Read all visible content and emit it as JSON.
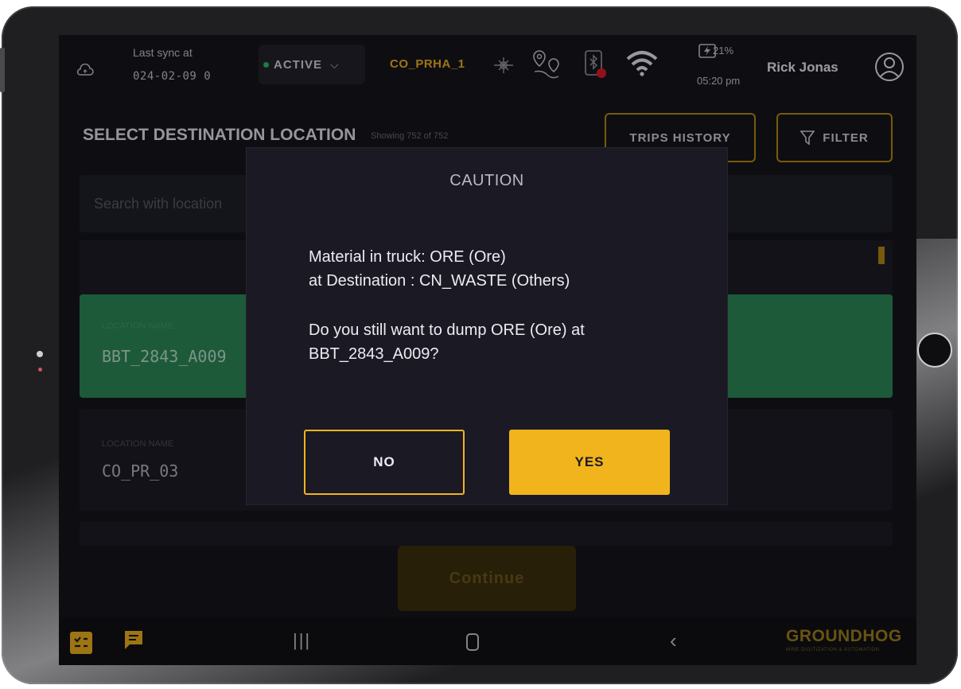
{
  "status_bar": {
    "sync_label": "Last sync at",
    "sync_value": "024-02-09 0",
    "status": "ACTIVE",
    "route": "CO_PRHA_1",
    "battery": "21%",
    "time": "05:20 pm",
    "user": "Rick Jonas"
  },
  "header": {
    "title": "SELECT DESTINATION LOCATION",
    "showing": "Showing 752 of 752",
    "trips_history": "TRIPS HISTORY",
    "filter": "FILTER"
  },
  "search": {
    "placeholder": "Search with location"
  },
  "locations": [
    {
      "label": "LOCATION NAME",
      "name": "BBT_2843_A009",
      "selected": true
    },
    {
      "label": "LOCATION NAME",
      "name": "CO_PR_03",
      "selected": false
    }
  ],
  "continue_label": "Continue",
  "brand": {
    "name": "GROUNDHOG",
    "tagline": "MINE DIGITIZATION & AUTOMATION"
  },
  "modal": {
    "title": "CAUTION",
    "line1": "Material in truck: ORE (Ore)",
    "line2": "at Destination : CN_WASTE (Others)",
    "line3": "Do you still want to dump ORE (Ore) at",
    "line4": "BBT_2843_A009?",
    "no_label": "NO",
    "yes_label": "YES"
  },
  "colors": {
    "accent": "#f2b41c",
    "selected_card": "#2c8b5a",
    "background": "#16161d",
    "status_active": "#2fbf5d"
  },
  "icons": [
    "cloud-icon",
    "chevron-down-icon",
    "drill-icon",
    "route-pins-icon",
    "bluetooth-device-icon",
    "wifi-icon",
    "battery-bolt-icon",
    "user-avatar-icon",
    "filter-icon",
    "checklist-icon",
    "chat-icon",
    "recent-apps-icon",
    "home-icon",
    "back-icon"
  ]
}
